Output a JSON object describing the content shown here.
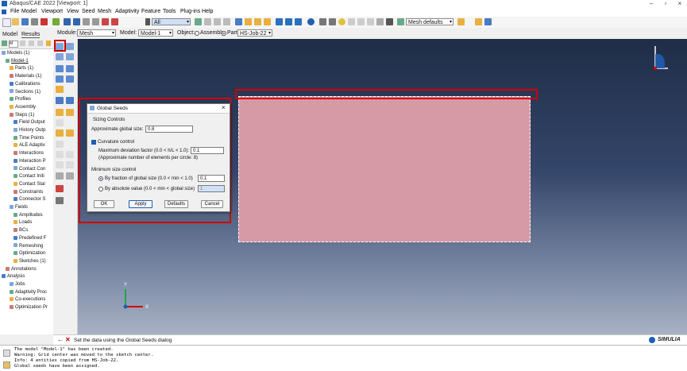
{
  "window": {
    "title": "Abaqus/CAE 2022 [Viewport: 1]"
  },
  "menu": [
    "File",
    "Model",
    "Viewport",
    "View",
    "Seed",
    "Mesh",
    "Adaptivity",
    "Feature",
    "Tools",
    "Plug-ins",
    "Help"
  ],
  "toolbar": {
    "select_value": "All",
    "mesh_defaults": "Mesh defaults"
  },
  "context": {
    "module_label": "Module:",
    "module_value": "Mesh",
    "model_label": "Model:",
    "model_value": "Model-1",
    "object_label": "Object:",
    "assembly_label": "Assembly",
    "part_label": "Part:",
    "part_value": "HS-Job-22"
  },
  "tree": {
    "tabs": [
      "Model",
      "Results"
    ],
    "mode_label": "M",
    "nodes": [
      {
        "label": "Models (1)",
        "indent": 0
      },
      {
        "label": "Model-1",
        "indent": 1
      },
      {
        "label": "Parts (1)",
        "indent": 2
      },
      {
        "label": "Materials (1)",
        "indent": 2
      },
      {
        "label": "Calibrations",
        "indent": 2
      },
      {
        "label": "Sections (1)",
        "indent": 2
      },
      {
        "label": "Profiles",
        "indent": 2
      },
      {
        "label": "Assembly",
        "indent": 2
      },
      {
        "label": "Steps (1)",
        "indent": 2
      },
      {
        "label": "Field Output",
        "indent": 3
      },
      {
        "label": "History Outp",
        "indent": 3
      },
      {
        "label": "Time Points",
        "indent": 3
      },
      {
        "label": "ALE Adaptiv",
        "indent": 3
      },
      {
        "label": "Interactions",
        "indent": 3
      },
      {
        "label": "Interaction P",
        "indent": 3
      },
      {
        "label": "Contact Con",
        "indent": 3
      },
      {
        "label": "Contact Initi",
        "indent": 3
      },
      {
        "label": "Contact Stal",
        "indent": 3
      },
      {
        "label": "Constraints",
        "indent": 3
      },
      {
        "label": "Connector S",
        "indent": 3
      },
      {
        "label": "Fields",
        "indent": 2
      },
      {
        "label": "Amplitudes",
        "indent": 3
      },
      {
        "label": "Loads",
        "indent": 3
      },
      {
        "label": "BCs",
        "indent": 3
      },
      {
        "label": "Predefined F",
        "indent": 3
      },
      {
        "label": "Remeshing",
        "indent": 3
      },
      {
        "label": "Optimization",
        "indent": 3
      },
      {
        "label": "Sketches (1)",
        "indent": 3
      },
      {
        "label": "Annotations",
        "indent": 1
      },
      {
        "label": "Analysis",
        "indent": 0
      },
      {
        "label": "Jobs",
        "indent": 2
      },
      {
        "label": "Adaptivity Proc",
        "indent": 2
      },
      {
        "label": "Co-executions",
        "indent": 2
      },
      {
        "label": "Optimization Pr",
        "indent": 2
      }
    ]
  },
  "dialog": {
    "title": "Global Seeds",
    "section_sizing": "Sizing Controls",
    "approx_size_label": "Approximate global size:",
    "approx_size_value": "0.8",
    "curvature_label": "Curvature control",
    "max_dev_label": "Maximum deviation factor (0.0 < h/L < 1.0):",
    "max_dev_value": "0.1",
    "approx_elems": "(Approximate number of elements per circle: 8)",
    "min_size_label": "Minimum size control",
    "by_fraction_label": "By fraction of global size  (0.0 < min < 1.0)",
    "by_fraction_value": "0.1",
    "by_absolute_label": "By absolute value  (0.0 < min < global size)",
    "by_absolute_value": "1",
    "ok": "OK",
    "apply": "Apply",
    "defaults": "Defaults",
    "cancel": "Cancel"
  },
  "prompt": {
    "text": "Set the data using the Global Seeds dialog"
  },
  "messages": [
    "The model \"Model-1\" has been created.",
    "Warning: Grid center was moved to the sketch center.",
    "Info: 4 entities copied from HS-Job-22.",
    "Global seeds have been assigned."
  ],
  "brand": "SIMULIA",
  "colors": {
    "accent": "#1e5fb4",
    "part": "#d69aa6",
    "highlight": "#d20000"
  }
}
